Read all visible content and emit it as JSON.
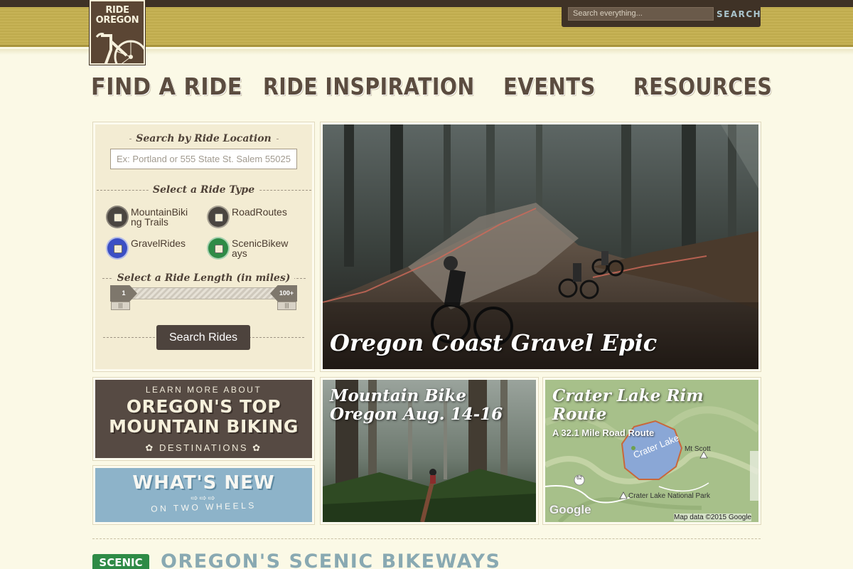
{
  "logo": {
    "line1": "RIDE",
    "line2": "OREGON"
  },
  "header_search": {
    "placeholder": "Search everything...",
    "button_label": "SEARCH"
  },
  "nav": [
    {
      "label": "FIND A RIDE"
    },
    {
      "label": "RIDE INSPIRATION"
    },
    {
      "label": "EVENTS"
    },
    {
      "label": "RESOURCES"
    }
  ],
  "ride_search": {
    "location_heading": "Search by Ride Location",
    "location_placeholder": "Ex: Portland or 555 State St. Salem 55025",
    "type_heading": "Select a Ride Type",
    "types": [
      {
        "label": "MountainBiking Trails",
        "color": "#4a4540"
      },
      {
        "label": "RoadRoutes",
        "color": "#4a4540"
      },
      {
        "label": "GravelRides",
        "color": "#3b4fc4"
      },
      {
        "label": "ScenicBikeways",
        "color": "#2e8b46"
      }
    ],
    "length_heading": "Select a Ride Length (in miles)",
    "length_min_label": "1",
    "length_max_label": "100+",
    "button_label": "Search Rides"
  },
  "feature": {
    "title": "Oregon Coast Gravel Epic"
  },
  "promos": {
    "mtb": {
      "line1": "LEARN MORE ABOUT",
      "line2": "OREGON'S TOP",
      "line3": "MOUNTAIN BIKING",
      "line4": "DESTINATIONS"
    },
    "whats_new": {
      "line1": "WHAT'S NEW",
      "line2": "ON TWO WHEELS"
    }
  },
  "event_tile": {
    "title_line1": "Mountain Bike",
    "title_line2": "Oregon Aug. 14-16"
  },
  "map_tile": {
    "title_line1": "Crater Lake Rim",
    "title_line2": "Route",
    "subtitle": "A 32.1 Mile Road Route",
    "lake_label": "Crater Lake",
    "peak_label": "Mt Scott",
    "park_label": "Crater Lake National Park",
    "road_number": "62",
    "map_brand": "Google",
    "attribution": "Map data ©2015 Google"
  },
  "bottom_section": {
    "tag": "SCENIC",
    "title": "OREGON'S SCENIC BIKEWAYS"
  },
  "colors": {
    "brown": "#4a3b2f",
    "olive": "#c7b356",
    "cream": "#fbf9e6",
    "scenic_green": "#2e8b46",
    "sky": "#8db3c9"
  }
}
